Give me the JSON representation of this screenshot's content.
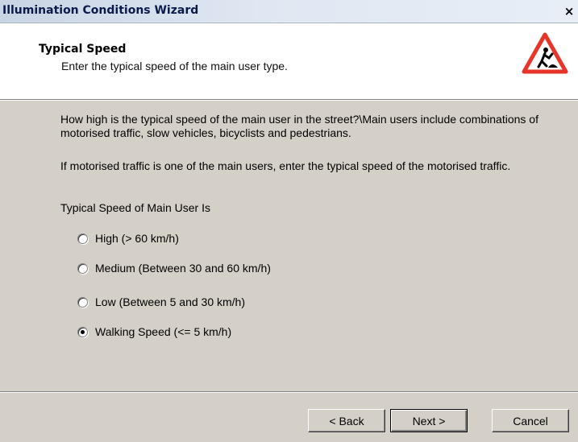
{
  "window": {
    "title": "Illumination Conditions Wizard",
    "close_glyph": "×"
  },
  "header": {
    "title": "Typical Speed",
    "subtitle": "Enter the typical speed of the main user type.",
    "icon": "road-works-warning-icon"
  },
  "body": {
    "paragraph1": "How high is the typical speed of the main user in the street?\\Main users include combinations of motorised traffic, slow vehicles, bicyclists and pedestrians.",
    "paragraph2": "If motorised traffic is one of the main users, enter the typical speed of the motorised traffic.",
    "group_label": "Typical Speed of Main User Is",
    "options": [
      {
        "label": "High (> 60 km/h)",
        "selected": false
      },
      {
        "label": "Medium (Between 30 and 60 km/h)",
        "selected": false
      },
      {
        "label": "Low (Between 5 and 30 km/h)",
        "selected": false
      },
      {
        "label": "Walking Speed (<= 5 km/h)",
        "selected": true
      }
    ]
  },
  "buttons": {
    "back": "< Back",
    "next": "Next >",
    "cancel": "Cancel"
  },
  "colors": {
    "face": "#d4d0c8",
    "warning_red": "#e8352a"
  }
}
